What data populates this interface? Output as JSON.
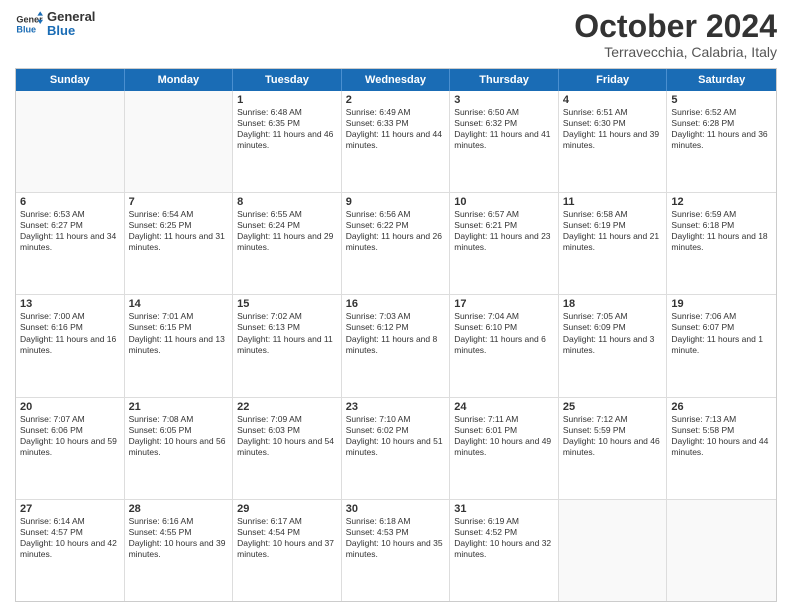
{
  "header": {
    "logo_line1": "General",
    "logo_line2": "Blue",
    "month": "October 2024",
    "location": "Terravecchia, Calabria, Italy"
  },
  "days": [
    "Sunday",
    "Monday",
    "Tuesday",
    "Wednesday",
    "Thursday",
    "Friday",
    "Saturday"
  ],
  "rows": [
    [
      {
        "day": "",
        "text": ""
      },
      {
        "day": "",
        "text": ""
      },
      {
        "day": "1",
        "text": "Sunrise: 6:48 AM\nSunset: 6:35 PM\nDaylight: 11 hours and 46 minutes."
      },
      {
        "day": "2",
        "text": "Sunrise: 6:49 AM\nSunset: 6:33 PM\nDaylight: 11 hours and 44 minutes."
      },
      {
        "day": "3",
        "text": "Sunrise: 6:50 AM\nSunset: 6:32 PM\nDaylight: 11 hours and 41 minutes."
      },
      {
        "day": "4",
        "text": "Sunrise: 6:51 AM\nSunset: 6:30 PM\nDaylight: 11 hours and 39 minutes."
      },
      {
        "day": "5",
        "text": "Sunrise: 6:52 AM\nSunset: 6:28 PM\nDaylight: 11 hours and 36 minutes."
      }
    ],
    [
      {
        "day": "6",
        "text": "Sunrise: 6:53 AM\nSunset: 6:27 PM\nDaylight: 11 hours and 34 minutes."
      },
      {
        "day": "7",
        "text": "Sunrise: 6:54 AM\nSunset: 6:25 PM\nDaylight: 11 hours and 31 minutes."
      },
      {
        "day": "8",
        "text": "Sunrise: 6:55 AM\nSunset: 6:24 PM\nDaylight: 11 hours and 29 minutes."
      },
      {
        "day": "9",
        "text": "Sunrise: 6:56 AM\nSunset: 6:22 PM\nDaylight: 11 hours and 26 minutes."
      },
      {
        "day": "10",
        "text": "Sunrise: 6:57 AM\nSunset: 6:21 PM\nDaylight: 11 hours and 23 minutes."
      },
      {
        "day": "11",
        "text": "Sunrise: 6:58 AM\nSunset: 6:19 PM\nDaylight: 11 hours and 21 minutes."
      },
      {
        "day": "12",
        "text": "Sunrise: 6:59 AM\nSunset: 6:18 PM\nDaylight: 11 hours and 18 minutes."
      }
    ],
    [
      {
        "day": "13",
        "text": "Sunrise: 7:00 AM\nSunset: 6:16 PM\nDaylight: 11 hours and 16 minutes."
      },
      {
        "day": "14",
        "text": "Sunrise: 7:01 AM\nSunset: 6:15 PM\nDaylight: 11 hours and 13 minutes."
      },
      {
        "day": "15",
        "text": "Sunrise: 7:02 AM\nSunset: 6:13 PM\nDaylight: 11 hours and 11 minutes."
      },
      {
        "day": "16",
        "text": "Sunrise: 7:03 AM\nSunset: 6:12 PM\nDaylight: 11 hours and 8 minutes."
      },
      {
        "day": "17",
        "text": "Sunrise: 7:04 AM\nSunset: 6:10 PM\nDaylight: 11 hours and 6 minutes."
      },
      {
        "day": "18",
        "text": "Sunrise: 7:05 AM\nSunset: 6:09 PM\nDaylight: 11 hours and 3 minutes."
      },
      {
        "day": "19",
        "text": "Sunrise: 7:06 AM\nSunset: 6:07 PM\nDaylight: 11 hours and 1 minute."
      }
    ],
    [
      {
        "day": "20",
        "text": "Sunrise: 7:07 AM\nSunset: 6:06 PM\nDaylight: 10 hours and 59 minutes."
      },
      {
        "day": "21",
        "text": "Sunrise: 7:08 AM\nSunset: 6:05 PM\nDaylight: 10 hours and 56 minutes."
      },
      {
        "day": "22",
        "text": "Sunrise: 7:09 AM\nSunset: 6:03 PM\nDaylight: 10 hours and 54 minutes."
      },
      {
        "day": "23",
        "text": "Sunrise: 7:10 AM\nSunset: 6:02 PM\nDaylight: 10 hours and 51 minutes."
      },
      {
        "day": "24",
        "text": "Sunrise: 7:11 AM\nSunset: 6:01 PM\nDaylight: 10 hours and 49 minutes."
      },
      {
        "day": "25",
        "text": "Sunrise: 7:12 AM\nSunset: 5:59 PM\nDaylight: 10 hours and 46 minutes."
      },
      {
        "day": "26",
        "text": "Sunrise: 7:13 AM\nSunset: 5:58 PM\nDaylight: 10 hours and 44 minutes."
      }
    ],
    [
      {
        "day": "27",
        "text": "Sunrise: 6:14 AM\nSunset: 4:57 PM\nDaylight: 10 hours and 42 minutes."
      },
      {
        "day": "28",
        "text": "Sunrise: 6:16 AM\nSunset: 4:55 PM\nDaylight: 10 hours and 39 minutes."
      },
      {
        "day": "29",
        "text": "Sunrise: 6:17 AM\nSunset: 4:54 PM\nDaylight: 10 hours and 37 minutes."
      },
      {
        "day": "30",
        "text": "Sunrise: 6:18 AM\nSunset: 4:53 PM\nDaylight: 10 hours and 35 minutes."
      },
      {
        "day": "31",
        "text": "Sunrise: 6:19 AM\nSunset: 4:52 PM\nDaylight: 10 hours and 32 minutes."
      },
      {
        "day": "",
        "text": ""
      },
      {
        "day": "",
        "text": ""
      }
    ]
  ]
}
